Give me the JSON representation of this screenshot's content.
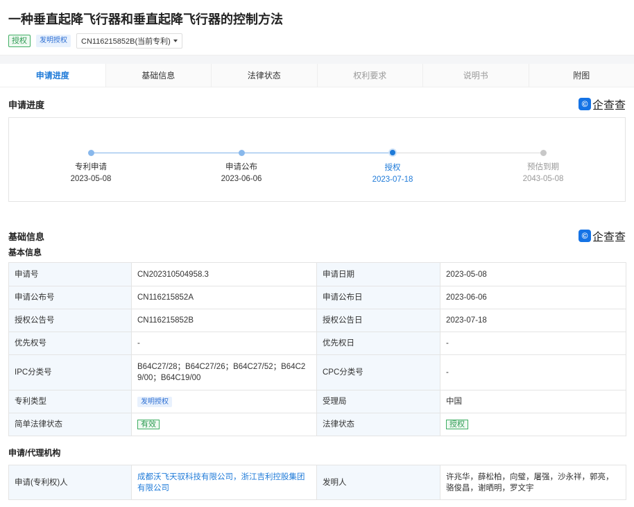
{
  "patent": {
    "title": "一种垂直起降飞行器和垂直起降飞行器的控制方法",
    "status_tag": "授权",
    "type_tag": "发明授权",
    "number_select": "CN116215852B(当前专利)"
  },
  "tabs": [
    {
      "label": "申请进度",
      "state": "active"
    },
    {
      "label": "基础信息",
      "state": "normal"
    },
    {
      "label": "法律状态",
      "state": "normal"
    },
    {
      "label": "权利要求",
      "state": "disabled"
    },
    {
      "label": "说明书",
      "state": "disabled"
    },
    {
      "label": "附图",
      "state": "normal"
    }
  ],
  "progress": {
    "title": "申请进度",
    "brand": "企查查",
    "steps": [
      {
        "label": "专利申请",
        "date": "2023-05-08",
        "state": "done"
      },
      {
        "label": "申请公布",
        "date": "2023-06-06",
        "state": "done"
      },
      {
        "label": "授权",
        "date": "2023-07-18",
        "state": "current"
      },
      {
        "label": "预估到期",
        "date": "2043-05-08",
        "state": "future"
      }
    ]
  },
  "basic": {
    "title": "基础信息",
    "brand": "企查查",
    "subtitle": "基本信息",
    "rows": [
      {
        "k1": "申请号",
        "v1": "CN202310504958.3",
        "k2": "申请日期",
        "v2": "2023-05-08"
      },
      {
        "k1": "申请公布号",
        "v1": "CN116215852A",
        "k2": "申请公布日",
        "v2": "2023-06-06"
      },
      {
        "k1": "授权公告号",
        "v1": "CN116215852B",
        "k2": "授权公告日",
        "v2": "2023-07-18"
      },
      {
        "k1": "优先权号",
        "v1": "-",
        "k2": "优先权日",
        "v2": "-"
      },
      {
        "k1": "IPC分类号",
        "v1": "B64C27/28；B64C27/26；B64C27/52；B64C29/00；B64C19/00",
        "k2": "CPC分类号",
        "v2": "-"
      },
      {
        "k1": "专利类型",
        "v1": "发明授权",
        "k2": "受理局",
        "v2": "中国"
      },
      {
        "k1": "简单法律状态",
        "v1": "有效",
        "k2": "法律状态",
        "v2": "授权"
      }
    ]
  },
  "agency": {
    "title": "申请/代理机构",
    "applicant_label": "申请(专利权)人",
    "applicant_value": "成都沃飞天驭科技有限公司，浙江吉利控股集团有限公司",
    "inventor_label": "发明人",
    "inventor_value": "许兆华，薛松柏，向璧，屠强，沙永祥，郭亮，骆俊昌，谢晒明，罗文宇"
  },
  "colors": {
    "accent": "#1e7ad8",
    "green": "#2e9b53",
    "key_bg": "#f3f8fd"
  }
}
